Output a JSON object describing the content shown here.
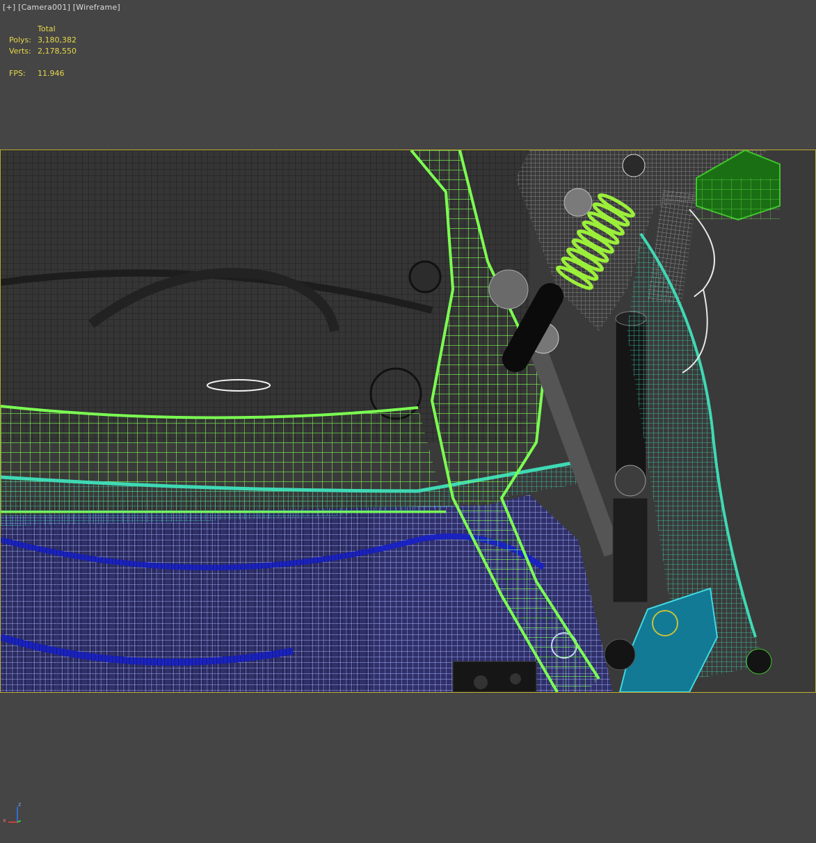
{
  "viewport": {
    "label_plus": "[+]",
    "label_camera": "[Camera001]",
    "label_mode": "[Wireframe]"
  },
  "stats": {
    "header": "Total",
    "polys_label": "Polys:",
    "polys_value": "3,180,382",
    "verts_label": "Verts:",
    "verts_value": "2,178,550",
    "fps_label": "FPS:",
    "fps_value": "11.946"
  },
  "axis": {
    "z_label": "z",
    "x_label": "x"
  },
  "colors": {
    "background": "#454545",
    "stats_text": "#e8d84a",
    "safe_frame": "#bfae2e",
    "wire_green": "#7cff52",
    "wire_teal": "#3fd9b4",
    "wire_blue": "#2a2fc8",
    "wire_light_blue": "#9fb0ff",
    "wire_black": "#111111",
    "wire_grey": "#9a9a9a"
  }
}
